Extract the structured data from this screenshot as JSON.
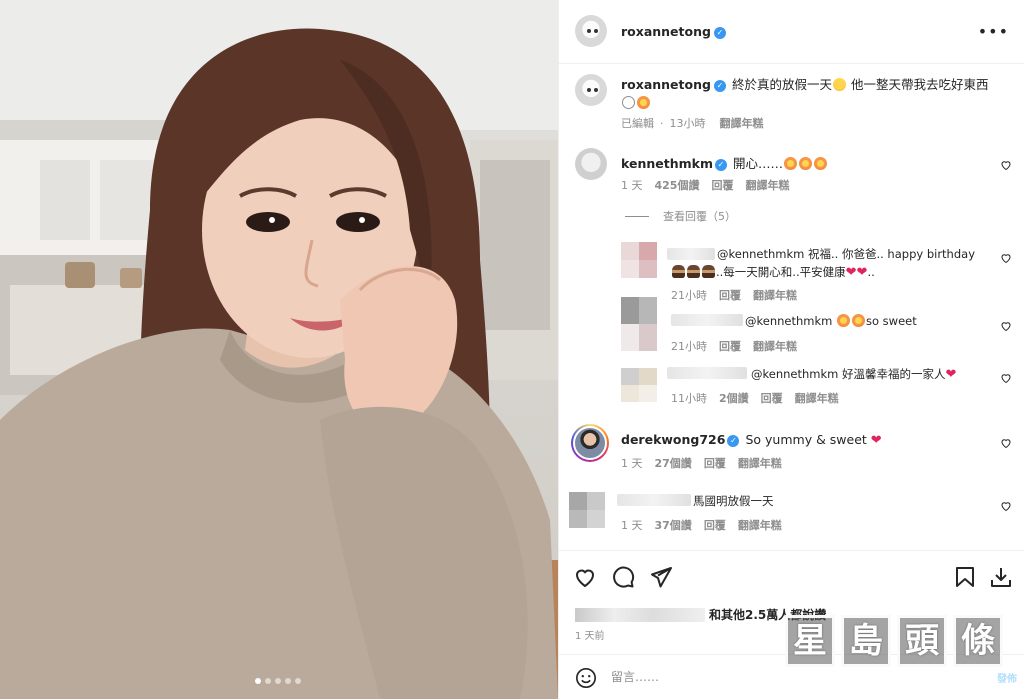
{
  "post": {
    "author": "roxannetong",
    "caption_text": "終於真的放假一天",
    "caption_text_2": "他一整天帶我去吃好東西",
    "caption_meta": {
      "edited": "已編輯",
      "time": "13小時",
      "translate": "翻譯年糕"
    },
    "carousel_dots": 5,
    "carousel_active": 0
  },
  "comments": [
    {
      "user": "kennethmkm",
      "text": "開心……",
      "time": "1 天",
      "likes": "425個讚",
      "reply": "回覆",
      "translate": "翻譯年糕"
    },
    {
      "view_replies": "查看回覆（5）"
    },
    {
      "user": "",
      "text_prefix": "@kennethmkm 祝福.. 你爸爸.. happy birthday",
      "text_line2": "..每一天開心和..平安健康",
      "text_end": "..",
      "time": "21小時",
      "reply": "回覆",
      "translate": "翻譯年糕"
    },
    {
      "user": "",
      "mention": "@kennethmkm",
      "text": "so sweet",
      "time": "21小時",
      "reply": "回覆",
      "translate": "翻譯年糕"
    },
    {
      "user": "",
      "mention": "@kennethmkm",
      "text": "好溫馨幸福的一家人",
      "time": "11小時",
      "likes": "2個讚",
      "reply": "回覆",
      "translate": "翻譯年糕"
    },
    {
      "user": "derekwong726",
      "text": "So yummy & sweet",
      "time": "1 天",
      "likes": "27個讚",
      "reply": "回覆",
      "translate": "翻譯年糕"
    },
    {
      "user": "",
      "text": "馬國明放假一天",
      "time": "1 天",
      "likes": "37個讚",
      "reply": "回覆",
      "translate": "翻譯年糕"
    }
  ],
  "likes": {
    "text": "和其他2.5萬人都說讚",
    "time": "1 天前"
  },
  "comment_input": {
    "placeholder": "留言……",
    "post_label": "發佈"
  },
  "watermark": {
    "chars": [
      "星",
      "島",
      "頭",
      "條"
    ]
  },
  "colors": {
    "verified": "#3897f0",
    "heart": "#e0245e",
    "meta": "#8e8e8e"
  },
  "icons": [
    "more-icon",
    "heart-icon",
    "comment-icon",
    "share-icon",
    "save-icon",
    "download-icon",
    "smile-icon",
    "verified-icon"
  ]
}
